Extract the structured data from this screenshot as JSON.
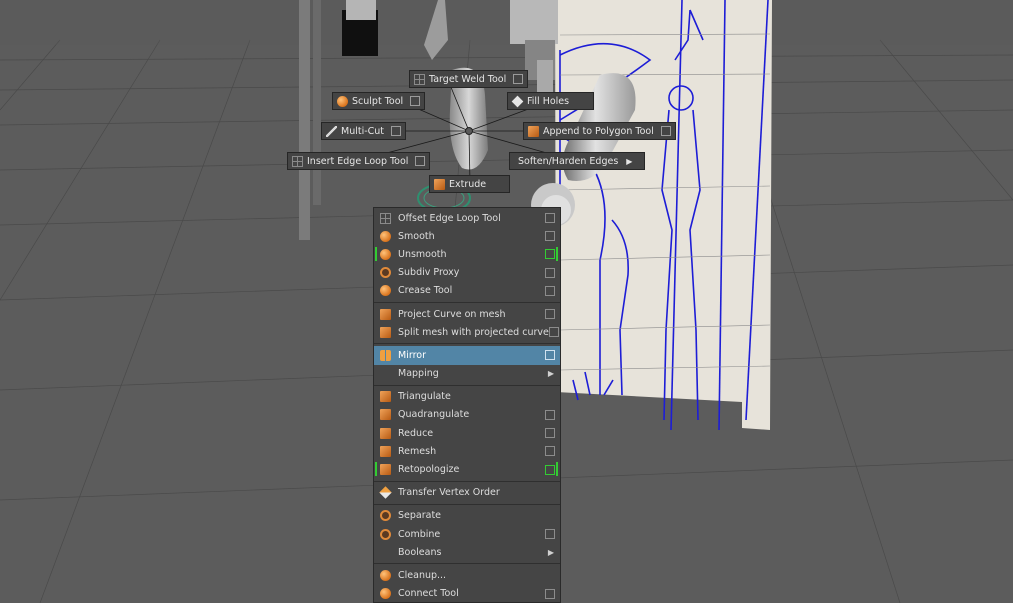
{
  "marking_menu": {
    "target_weld": "Target Weld Tool",
    "sculpt": "Sculpt Tool",
    "fill_holes": "Fill Holes",
    "multi_cut": "Multi-Cut",
    "append_polygon": "Append to Polygon Tool",
    "insert_edge_loop": "Insert Edge Loop Tool",
    "soften_harden": "Soften/Harden Edges",
    "extrude": "Extrude"
  },
  "menu": {
    "items": [
      {
        "label": "Offset Edge Loop Tool"
      },
      {
        "label": "Smooth"
      },
      {
        "label": "Unsmooth"
      },
      {
        "label": "Subdiv Proxy"
      },
      {
        "label": "Crease Tool"
      },
      {
        "label": "Project Curve on mesh"
      },
      {
        "label": "Split mesh with projected curve"
      },
      {
        "label": "Mirror"
      },
      {
        "label": "Mapping"
      },
      {
        "label": "Triangulate"
      },
      {
        "label": "Quadrangulate"
      },
      {
        "label": "Reduce"
      },
      {
        "label": "Remesh"
      },
      {
        "label": "Retopologize"
      },
      {
        "label": "Transfer Vertex Order"
      },
      {
        "label": "Separate"
      },
      {
        "label": "Combine"
      },
      {
        "label": "Booleans"
      },
      {
        "label": "Cleanup..."
      },
      {
        "label": "Connect Tool"
      }
    ]
  },
  "colors": {
    "highlight": "#5285a6",
    "green_marker": "#33cc33",
    "wire": "#2a2aff"
  }
}
